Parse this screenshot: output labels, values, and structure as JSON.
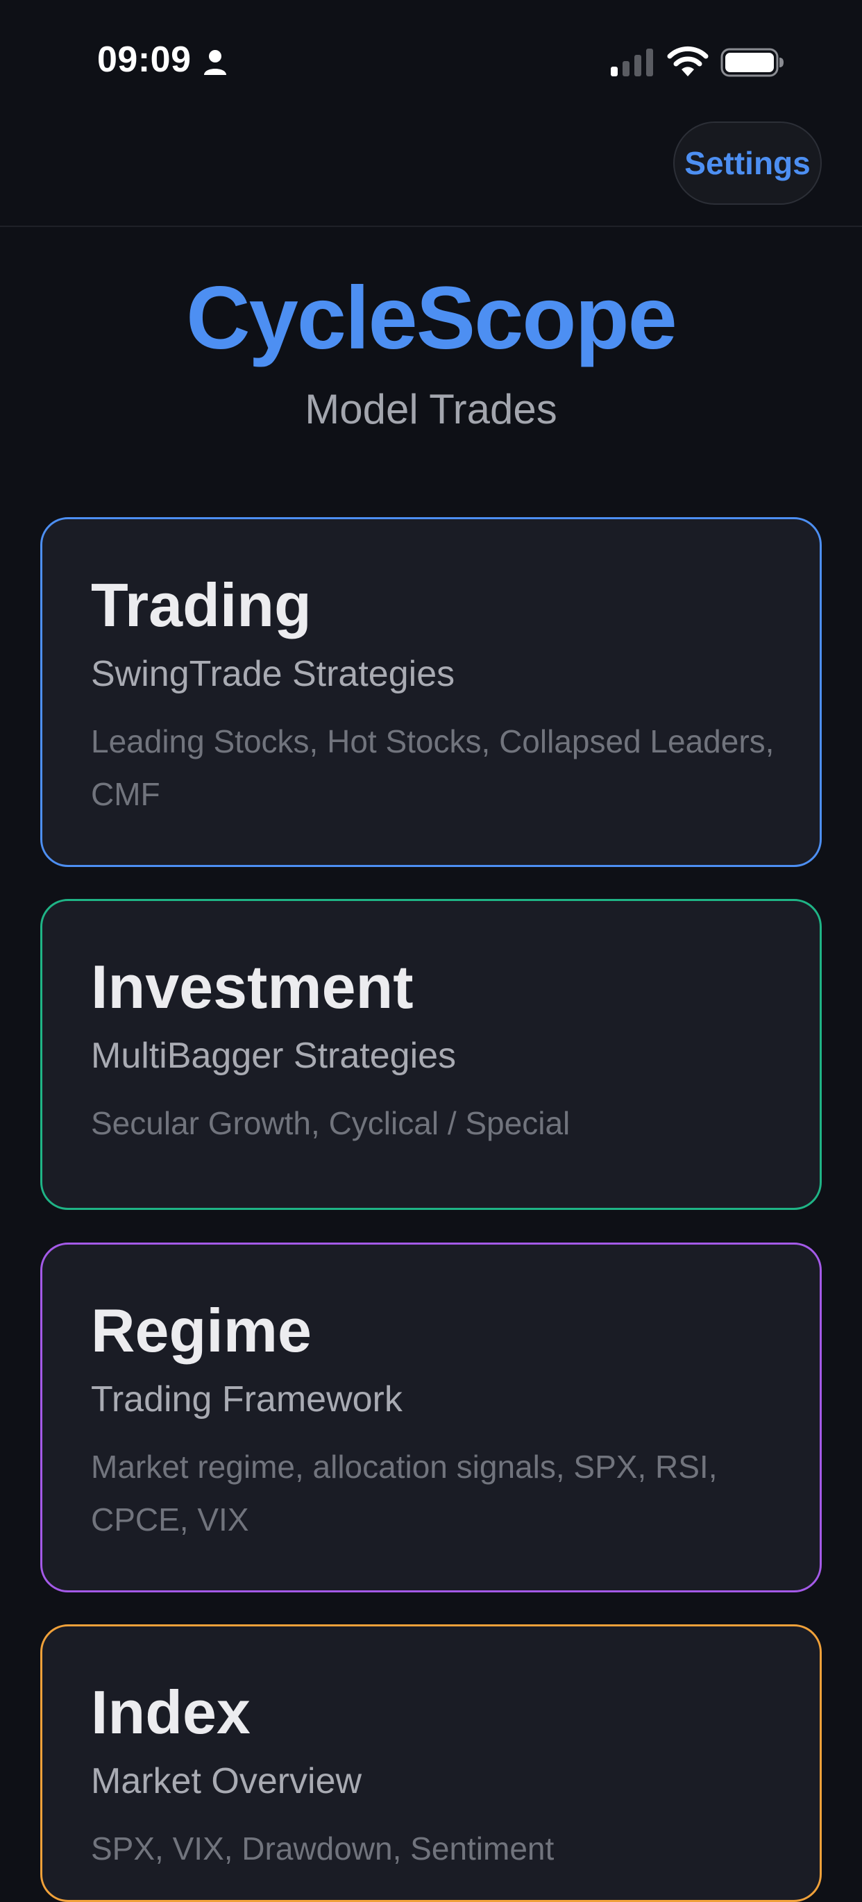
{
  "status_bar": {
    "time": "09:09",
    "icons": [
      "person-icon",
      "cellular-signal-icon",
      "wifi-icon",
      "battery-icon"
    ]
  },
  "nav": {
    "settings_label": "Settings"
  },
  "header": {
    "title": "CycleScope",
    "subtitle": "Model Trades"
  },
  "cards": [
    {
      "title": "Trading",
      "subtitle": "SwingTrade Strategies",
      "description": "Leading Stocks, Hot Stocks, Collapsed Leaders, CMF",
      "accent": "#4d8ff2"
    },
    {
      "title": "Investment",
      "subtitle": "MultiBagger Strategies",
      "description": "Secular Growth, Cyclical / Special",
      "accent": "#1fb486"
    },
    {
      "title": "Regime",
      "subtitle": "Trading Framework",
      "description": "Market regime, allocation signals, SPX, RSI, CPCE, VIX",
      "accent": "#a45ae8"
    },
    {
      "title": "Index",
      "subtitle": "Market Overview",
      "description": "SPX, VIX, Drawdown, Sentiment",
      "accent": "#f0a13a"
    }
  ],
  "colors": {
    "background": "#0e1016",
    "card_background": "#1a1c25",
    "brand": "#4d8ff2"
  }
}
